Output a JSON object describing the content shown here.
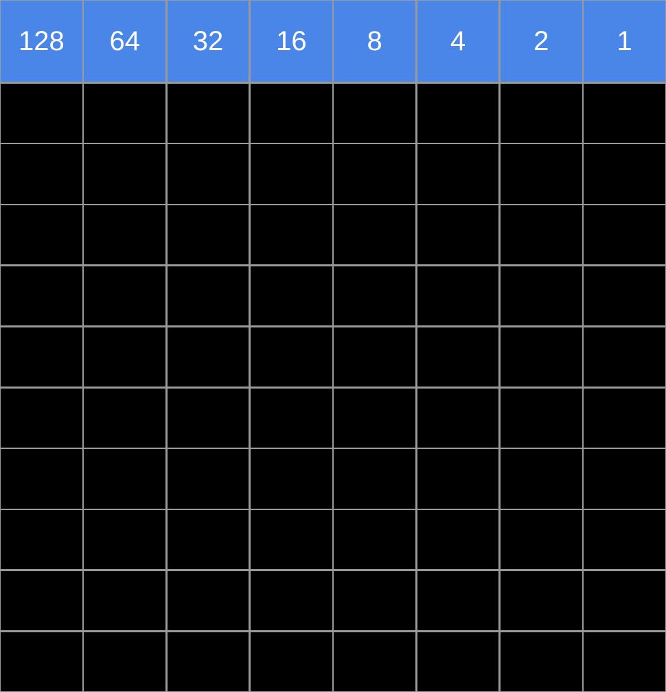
{
  "headers": [
    "128",
    "64",
    "32",
    "16",
    "8",
    "4",
    "2",
    "1"
  ],
  "rows": 10,
  "cols": 8,
  "colors": {
    "header_bg": "#4a86e8",
    "header_fg": "#ffffff",
    "cell_bg": "#000000",
    "grid_line": "#9a9a9a"
  },
  "chart_data": {
    "type": "table",
    "title": "",
    "columns": [
      "128",
      "64",
      "32",
      "16",
      "8",
      "4",
      "2",
      "1"
    ],
    "annotations": "8-bit place-value headers (powers of two from 128 to 1). Body is 10 rows × 8 columns of empty black cells."
  }
}
